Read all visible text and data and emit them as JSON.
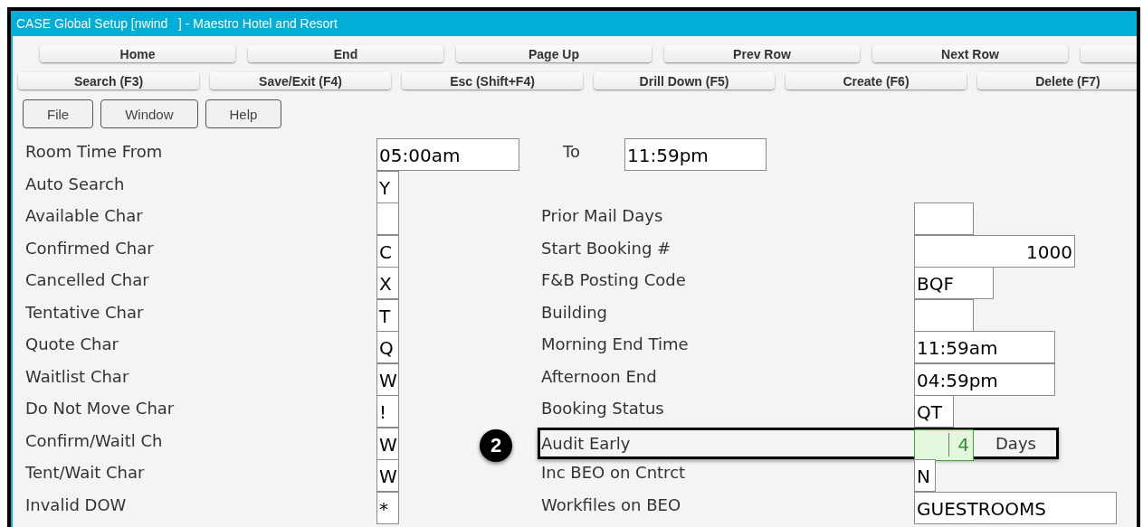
{
  "window": {
    "title": "CASE Global Setup [nwind   ] - Maestro Hotel and Resort"
  },
  "nav_rows": [
    [
      {
        "label": "Home"
      },
      {
        "label": "End"
      },
      {
        "label": "Page Up"
      },
      {
        "label": "Prev Row"
      },
      {
        "label": "Next Row"
      },
      {
        "kind": "blank"
      }
    ],
    [
      {
        "label": "Search (F3)"
      },
      {
        "label": "Save/Exit (F4)"
      },
      {
        "label": "Esc (Shift+F4)"
      },
      {
        "label": "Drill Down (F5)"
      },
      {
        "label": "Create (F6)"
      },
      {
        "label": "Delete (F7)"
      }
    ]
  ],
  "menu": [
    "File",
    "Window",
    "Help"
  ],
  "room_time": {
    "label": "Room Time From",
    "from": "05:00am",
    "to_label": "To",
    "to": "11:59pm"
  },
  "rows": [
    {
      "left": {
        "label": "Auto Search",
        "value": "Y"
      }
    },
    {
      "left": {
        "label": "Available Char"
      },
      "right": {
        "label": "Prior Mail Days",
        "kind": "short"
      }
    },
    {
      "left": {
        "label": "Confirmed Char",
        "value": "C"
      },
      "right": {
        "label": "Start Booking #",
        "kind": "number",
        "value": "1000"
      }
    },
    {
      "left": {
        "label": "Cancelled Char",
        "value": "X"
      },
      "right": {
        "label": "F&B Posting Code",
        "kind": "code",
        "value": "BQF"
      }
    },
    {
      "left": {
        "label": "Tentative Char",
        "value": "T"
      },
      "right": {
        "label": "Building",
        "kind": "short"
      }
    },
    {
      "left": {
        "label": "Quote Char",
        "value": "Q"
      },
      "right": {
        "label": "Morning End Time",
        "kind": "time",
        "value": "11:59am"
      }
    },
    {
      "left": {
        "label": "Waitlist Char",
        "value": "W"
      },
      "right": {
        "label": "Afternoon End",
        "kind": "time",
        "value": "04:59pm"
      }
    },
    {
      "left": {
        "label": "Do Not Move Char",
        "value": "!"
      },
      "right": {
        "label": "Booking Status",
        "kind": "status",
        "value": "QT"
      }
    },
    {
      "left": {
        "label": "Confirm/Waitl Ch",
        "value": "W"
      },
      "right": {
        "label": "Audit Early",
        "kind": "days",
        "value": "4",
        "unit": "Days",
        "highlighted": true,
        "callout": "2"
      }
    },
    {
      "left": {
        "label": "Tent/Wait Char",
        "value": "W"
      },
      "right": {
        "label": "Inc BEO on Cntrct",
        "kind": "flag",
        "value": "N"
      }
    },
    {
      "left": {
        "label": "Invalid DOW",
        "value": "*"
      },
      "right": {
        "label": "Workfiles on BEO",
        "kind": "long",
        "value": "GUESTROOMS"
      }
    }
  ]
}
